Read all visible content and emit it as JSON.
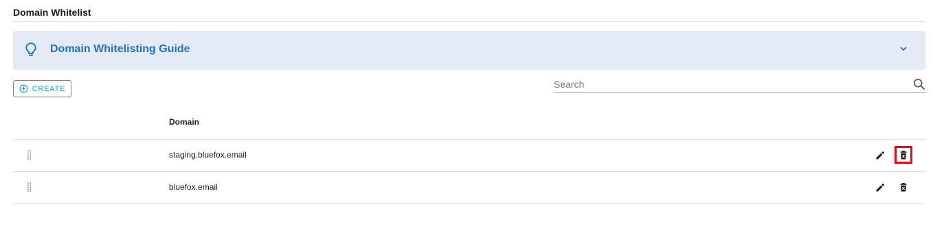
{
  "page": {
    "title": "Domain Whitelist"
  },
  "guide": {
    "title": "Domain Whitelisting Guide",
    "icon": "lightbulb-icon",
    "expand_icon": "chevron-down-icon"
  },
  "toolbar": {
    "create_label": "CREATE",
    "create_icon": "add-circle-icon"
  },
  "search": {
    "placeholder": "Search",
    "value": "",
    "icon": "search-icon"
  },
  "table": {
    "columns": [
      "Domain"
    ],
    "rows": [
      {
        "domain": "staging.bluefox.email",
        "delete_highlighted": true
      },
      {
        "domain": "bluefox.email",
        "delete_highlighted": false
      }
    ]
  },
  "colors": {
    "accent": "#1ea1d6",
    "guide_background": "#e4ebf6",
    "guide_title": "#1f6fc4",
    "highlight": "#e8090c"
  }
}
